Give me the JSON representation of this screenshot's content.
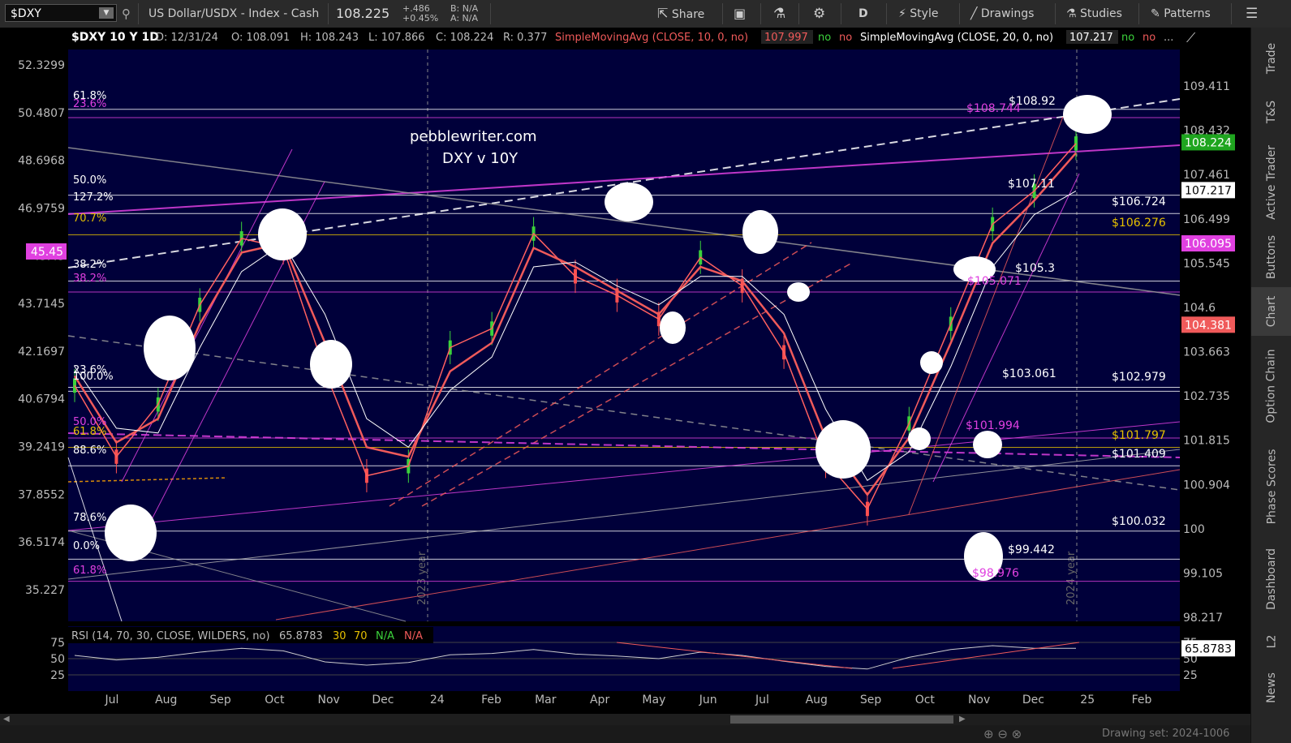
{
  "toolbar": {
    "symbol": "$DXY",
    "description": "US Dollar/USDX - Index - Cash",
    "last_price": "108.225",
    "change_abs": "+.486",
    "change_pct": "+0.45%",
    "bid": "B: N/A",
    "ask": "A: N/A",
    "share_label": "Share",
    "aggregation": "D",
    "style_label": "Style",
    "drawings_label": "Drawings",
    "studies_label": "Studies",
    "patterns_label": "Patterns"
  },
  "header": {
    "title": "$DXY 10 Y 1D",
    "date": "D: 12/31/24",
    "open": "O: 108.091",
    "high": "H: 108.243",
    "low": "L: 107.866",
    "close": "C: 108.224",
    "range": "R: 0.377",
    "sma10_label": "SimpleMovingAvg (CLOSE, 10, 0, no)",
    "sma10_value": "107.997",
    "sma20_label": "SimpleMovingAvg (CLOSE, 20, 0, no)",
    "sma20_value": "107.217",
    "flag_no": "no",
    "more": "..."
  },
  "annotation": {
    "line1": "pebblewriter.com",
    "line2": "DXY v 10Y"
  },
  "rsi_header": {
    "label": "RSI (14, 70, 30, CLOSE, WILDERS, no)",
    "value": "65.8783",
    "ob": "30",
    "os": "70",
    "na1": "N/A",
    "na2": "N/A"
  },
  "sidebar": [
    "Trade",
    "T&S",
    "Active Trader",
    "Buttons",
    "Chart",
    "Option Chain",
    "Phase Scores",
    "Dashboard",
    "L2",
    "News"
  ],
  "bottom": {
    "drawing_set": "Drawing set: 2024-1006"
  },
  "colors": {
    "background": "#00003a",
    "gold": "#e5c000",
    "magenta": "#e040e0",
    "pink": "#ff6ad0",
    "red_ma": "#f05a5a",
    "white": "#ffffff",
    "green_tag": "#1fa51f"
  },
  "chart_data": {
    "type": "line",
    "left_axis_ticks": [
      "52.3299",
      "50.4807",
      "48.6968",
      "46.9759",
      "45.45",
      "43.7145",
      "42.1697",
      "40.6794",
      "39.2419",
      "37.8552",
      "36.5174",
      "35.227"
    ],
    "left_axis_tag": "45.45",
    "right_axis_ticks": [
      "109.411",
      "108.432",
      "107.461",
      "106.499",
      "105.545",
      "104.6",
      "103.663",
      "102.735",
      "101.815",
      "100.904",
      "100",
      "99.105",
      "98.217"
    ],
    "right_axis_tags": [
      {
        "value": "108.224",
        "color": "#1fa51f"
      },
      {
        "value": "107.217",
        "color": "#ffffff"
      },
      {
        "value": "106.095",
        "color": "#e040e0"
      },
      {
        "value": "104.381",
        "color": "#f05a5a"
      }
    ],
    "x_ticks": [
      "Jul",
      "Aug",
      "Sep",
      "Oct",
      "Nov",
      "Dec",
      "24",
      "Feb",
      "Mar",
      "Apr",
      "May",
      "Jun",
      "Jul",
      "Aug",
      "Sep",
      "Oct",
      "Nov",
      "Dec",
      "25",
      "Feb"
    ],
    "year_markers": [
      "2023 year",
      "2024 year"
    ],
    "fib_labels_left": [
      "61.8%",
      "23.6%",
      "50.0%",
      "127.2%",
      "70.7%",
      "38.2%",
      "38.2%",
      "23.6%",
      "100.0%",
      "50.0%",
      "61.8%",
      "88.6%",
      "78.6%",
      "0.0%",
      "61.8%"
    ],
    "price_labels": [
      "$108.92",
      "$108.744",
      "$107.11",
      "$106.724",
      "$106.276",
      "$105.3",
      "$105.071",
      "$103.061",
      "$102.979",
      "$101.994",
      "$101.797",
      "$101.409",
      "$100.032",
      "$99.442",
      "$98.976"
    ],
    "series": [
      {
        "name": "$DXY",
        "values": [
          103.1,
          101.6,
          102.7,
          104.8,
          106.2,
          106.0,
          103.4,
          101.2,
          101.4,
          103.9,
          104.3,
          106.3,
          105.4,
          105.0,
          104.5,
          105.8,
          105.2,
          103.8,
          101.5,
          100.5,
          102.3,
          104.4,
          106.5,
          107.2,
          108.2
        ]
      },
      {
        "name": "SimpleMovingAvg (CLOSE, 10, 0, no)",
        "values": [
          103.3,
          101.9,
          102.4,
          104.4,
          105.9,
          106.1,
          104.0,
          101.8,
          101.6,
          103.4,
          104.0,
          106.0,
          105.6,
          105.1,
          104.6,
          105.6,
          105.3,
          104.2,
          102.0,
          100.8,
          102.0,
          104.0,
          106.1,
          107.0,
          108.0
        ]
      },
      {
        "name": "SimpleMovingAvg (CLOSE, 20, 0, no)",
        "values": [
          103.5,
          102.2,
          102.1,
          103.9,
          105.5,
          106.1,
          104.6,
          102.4,
          101.8,
          103.0,
          103.7,
          105.6,
          105.7,
          105.2,
          104.8,
          105.4,
          105.4,
          104.6,
          102.6,
          101.1,
          101.7,
          103.5,
          105.6,
          106.7,
          107.2
        ]
      }
    ],
    "rsi": {
      "ticks": [
        "75",
        "50",
        "25"
      ],
      "value": 65.8783,
      "values": [
        55,
        48,
        52,
        60,
        66,
        62,
        45,
        40,
        44,
        56,
        58,
        64,
        57,
        54,
        50,
        60,
        55,
        46,
        38,
        34,
        52,
        64,
        70,
        66,
        66
      ]
    }
  }
}
